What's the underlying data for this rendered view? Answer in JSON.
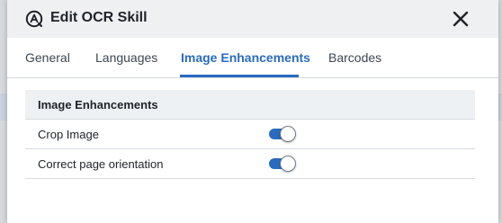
{
  "dialog": {
    "title": "Edit OCR Skill",
    "app_icon": "ocr-skill-icon",
    "close_icon": "close-icon"
  },
  "tabs": [
    {
      "label": "General",
      "active": false
    },
    {
      "label": "Languages",
      "active": false
    },
    {
      "label": "Image Enhancements",
      "active": true
    },
    {
      "label": "Barcodes",
      "active": false
    }
  ],
  "section": {
    "heading": "Image Enhancements",
    "rows": [
      {
        "label": "Crop Image",
        "enabled": true
      },
      {
        "label": "Correct page orientation",
        "enabled": true
      }
    ]
  },
  "colors": {
    "accent": "#2a6bbf",
    "header_bg": "#eef0f2",
    "section_header_bg": "#eef1f4"
  }
}
